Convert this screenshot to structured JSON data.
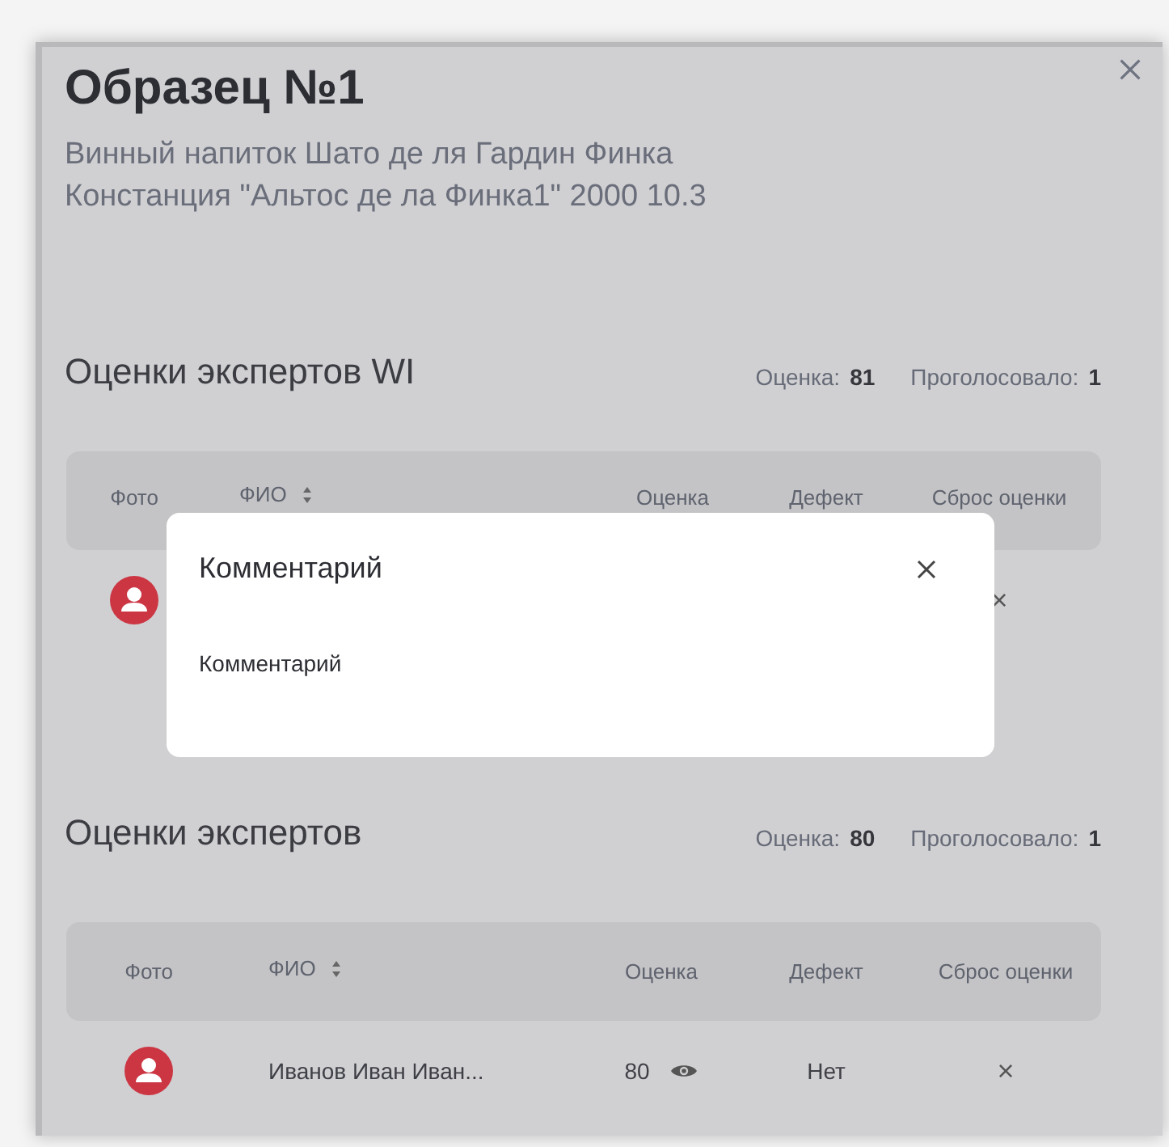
{
  "panel": {
    "title": "Образец №1",
    "subtitle_lines": [
      "Винный напиток Шато де ля Гардин Финка",
      "Констанция \"Альтос де ла Финка1\" 2000 10.3"
    ]
  },
  "sections": [
    {
      "heading": "Оценки экспертов WI",
      "score_label": "Оценка:",
      "score": "81",
      "votes_label": "Проголосовало:",
      "votes": "1",
      "columns": [
        "Фото",
        "ФИО",
        "Оценка",
        "Дефект",
        "Сброс оценки"
      ],
      "rows": [
        {
          "reset": "×"
        }
      ]
    },
    {
      "heading": "Оценки экспертов",
      "score_label": "Оценка:",
      "score": "80",
      "votes_label": "Проголосовало:",
      "votes": "1",
      "columns": [
        "Фото",
        "ФИО",
        "Оценка",
        "Дефект",
        "Сброс оценки"
      ],
      "rows": [
        {
          "name": "Иванов Иван Иван...",
          "score": "80",
          "defect": "Нет",
          "reset": "×"
        }
      ]
    }
  ],
  "dialog": {
    "title": "Комментарий",
    "body": "Комментарий"
  }
}
